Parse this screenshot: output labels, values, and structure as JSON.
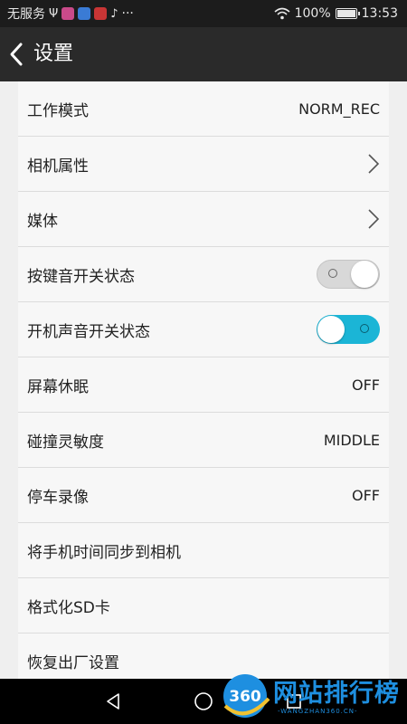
{
  "status_bar": {
    "carrier": "无服务",
    "icons_left": [
      "usb-icon",
      "app-icon",
      "app-icon",
      "app-icon",
      "tiktok-icon"
    ],
    "more": "···",
    "battery": "100%",
    "battery_level": 1.0,
    "time": "13:53"
  },
  "header": {
    "title": "设置"
  },
  "settings": [
    {
      "label": "工作模式",
      "value": "NORM_REC"
    },
    {
      "label": "相机属性"
    },
    {
      "label": "媒体"
    },
    {
      "label": "按键音开关状态",
      "toggle": false
    },
    {
      "label": "开机声音开关状态",
      "toggle": true
    },
    {
      "label": "屏幕休眠",
      "value": "OFF"
    },
    {
      "label": "碰撞灵敏度",
      "value": "MIDDLE"
    },
    {
      "label": "停车录像",
      "value": "OFF"
    },
    {
      "label": "将手机时间同步到相机"
    },
    {
      "label": "格式化SD卡"
    },
    {
      "label": "恢复出厂设置"
    }
  ],
  "watermark": {
    "text": "网站排行榜",
    "sub": "-WANGZHAN360.CN-",
    "logo": "360"
  },
  "colors": {
    "accent": "#1bb5d6",
    "header_bg": "#2a2a2a",
    "watermark": "#1e8fe0"
  }
}
